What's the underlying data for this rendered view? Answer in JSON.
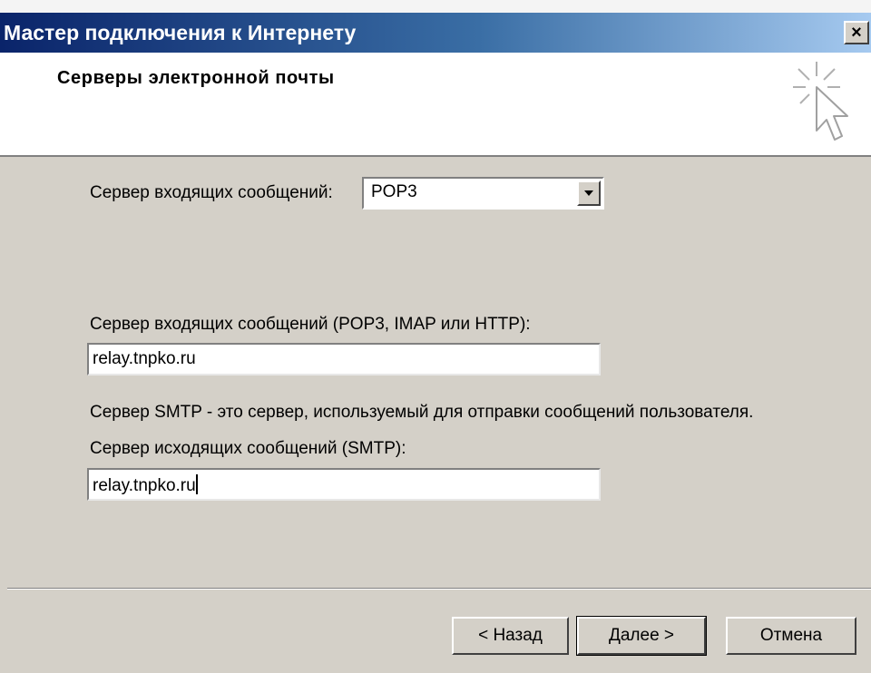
{
  "window": {
    "title": "Мастер подключения к Интернету",
    "close_symbol": "×"
  },
  "header": {
    "title": "Серверы электронной почты",
    "icon": "wizard-cursor-icon"
  },
  "incoming_type": {
    "label": "Сервер входящих сообщений:",
    "selected": "POP3"
  },
  "incoming_server": {
    "label": "Сервер входящих сообщений (POP3, IMAP или HTTP):",
    "value": "relay.tnpko.ru"
  },
  "smtp_note": "Сервер SMTP - это сервер, используемый для отправки сообщений  пользователя.",
  "outgoing_server": {
    "label": "Сервер исходящих сообщений (SMTP):",
    "value": "relay.tnpko.ru"
  },
  "buttons": {
    "back": "< Назад",
    "next": "Далее >",
    "cancel": "Отмена"
  },
  "colors": {
    "titlebar_start": "#0a246a",
    "titlebar_end": "#a6caf0",
    "face": "#d4d0c8"
  }
}
